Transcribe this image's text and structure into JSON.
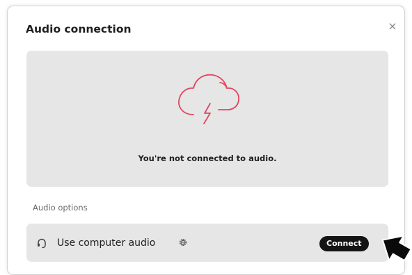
{
  "dialog": {
    "title": "Audio connection",
    "close_label": "×"
  },
  "status": {
    "icon": "disconnected-cloud-icon",
    "icon_color": "#e0475f",
    "message": "You're not connected to audio."
  },
  "options": {
    "section_label": "Audio options",
    "items": [
      {
        "icon": "headset-icon",
        "label": "Use computer audio",
        "settings_icon": "gear-icon",
        "button_label": "Connect"
      }
    ]
  },
  "cursor": {
    "icon": "arrow-pointer-icon"
  }
}
